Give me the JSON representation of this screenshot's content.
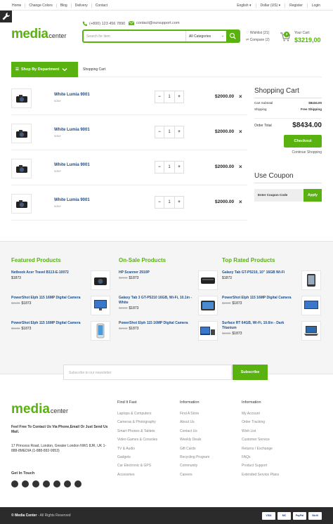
{
  "topbar": {
    "nav": [
      "Home",
      "Change Colors",
      "Blog",
      "Delivery",
      "Contact"
    ],
    "right": [
      "English",
      "Dollar (US)",
      "Register",
      "Login"
    ]
  },
  "logo": {
    "main": "media",
    "sub": "center"
  },
  "contact": {
    "phone": "(+800) 123 456 7890",
    "email": "contact@oursupport.com"
  },
  "search": {
    "placeholder": "Search for item",
    "category": "All Categories"
  },
  "wishlist": {
    "label": "Wishlist (21)"
  },
  "compare": {
    "label": "Compare (2)"
  },
  "cart_summary": {
    "label": "Your Cart:",
    "amount": "$3219,00",
    "count": "3"
  },
  "nav": {
    "department": "Shop By Department",
    "breadcrumb": "Shopping Cart"
  },
  "cart_items": [
    {
      "name": "White Lumia 9001",
      "brand": "SONY",
      "qty": "1",
      "price": "$2000.00"
    },
    {
      "name": "White Lumia 9001",
      "brand": "SONY",
      "qty": "1",
      "price": "$2000.00"
    },
    {
      "name": "White Lumia 9001",
      "brand": "SONY",
      "qty": "1",
      "price": "$2000.00"
    },
    {
      "name": "White Lumia 9001",
      "brand": "SONY",
      "qty": "1",
      "price": "$2000.00"
    }
  ],
  "summary": {
    "title": "Shopping Cart",
    "subtotal_label": "Cart Subtotal",
    "subtotal": "$8434.00",
    "shipping_label": "Shipping",
    "shipping": "Free Shipping",
    "total_label": "Order Total",
    "total": "$8434.00",
    "checkout": "Checkout",
    "continue": "Continue Shopping"
  },
  "coupon": {
    "title": "Use Coupon",
    "placeholder": "Enter Coupon Code",
    "apply": "Apply"
  },
  "featured": {
    "title": "Featured Products",
    "items": [
      {
        "name": "Netbook Acer Travel B113-E-10072",
        "old": "",
        "price": "$1873"
      },
      {
        "name": "PowerShot Elph 115 16MP Digital Camera",
        "old": "$2100",
        "price": "$1873"
      },
      {
        "name": "PowerShot Elph 115 16MP Digital Camera",
        "old": "$2100",
        "price": "$1873"
      }
    ]
  },
  "onsale": {
    "title": "On-Sale Products",
    "items": [
      {
        "name": "HP Scanner 2910P",
        "old": "$2100",
        "price": "$1873"
      },
      {
        "name": "Galaxy Tab 3 GT-P5210 16GB, Wi-Fi, 10.1in - White",
        "old": "$2100",
        "price": "$1873"
      },
      {
        "name": "PowerShot Elph 115 16MP Digital Camera",
        "old": "$2100",
        "price": "$1873"
      }
    ]
  },
  "toprated": {
    "title": "Top Rated Products",
    "items": [
      {
        "name": "Galaxy Tab GT-P5210, 10\" 16GB Wi-Fi",
        "old": "",
        "price": "$1873"
      },
      {
        "name": "PowerShot Elph 115 16MP Digital Camera",
        "old": "$2100",
        "price": "$1873"
      },
      {
        "name": "Surface RT 64GB, Wi-Fi, 10.6in - Dark Titanium",
        "old": "$2100",
        "price": "$1873"
      }
    ]
  },
  "newsletter": {
    "placeholder": "Subscribe to our newsletter",
    "button": "Subscribe"
  },
  "footer": {
    "call": "Feel Free To Contact Us Via Phone,Email Or Just Send Us Mail.",
    "address": "17 Princess Road, London, Greater London NW1 8JR, UK 1-888-8MEDIA (1-888-892-9953)",
    "get_in_touch": "Get In Touch",
    "find_title": "Find It Fast",
    "find": [
      "Laptops & Computers",
      "Cameras & Photography",
      "Smart Phones & Tablets",
      "Video Games & Consoles",
      "TV & Audio",
      "Gadgets",
      "Car Electronic & GPS",
      "Accesories"
    ],
    "info_title": "Information",
    "info": [
      "Find A Store",
      "About Us",
      "Contact Us",
      "Weekly Deals",
      "Gift Cards",
      "Recycling Program",
      "Community",
      "Careers"
    ],
    "info2_title": "Information",
    "info2": [
      "My Account",
      "Order Tracking",
      "Wish List",
      "Customer Service",
      "Returns / Exchange",
      "FAQs",
      "Product Support",
      "Extended Service Plans"
    ]
  },
  "bottom": {
    "brand": "© Media Center",
    "rights": " - All Rights Reserved",
    "cards": [
      "VISA",
      "MC",
      "PayPal",
      "Skrill"
    ]
  },
  "colors": {
    "accent": "#59b210",
    "link": "#1b4e8c"
  }
}
